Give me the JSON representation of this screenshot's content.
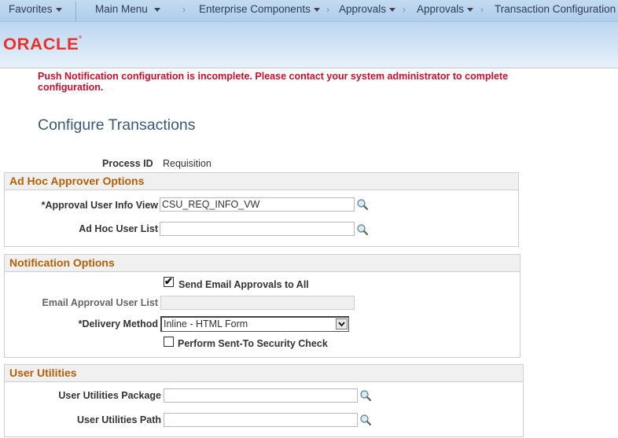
{
  "nav": {
    "favorites": "Favorites",
    "main_menu": "Main Menu",
    "breadcrumbs": [
      {
        "label": "Enterprise Components",
        "has_menu": true
      },
      {
        "label": "Approvals",
        "has_menu": true
      },
      {
        "label": "Approvals",
        "has_menu": true
      },
      {
        "label": "Transaction Configuration",
        "has_menu": false
      }
    ],
    "separator": "›"
  },
  "header": {
    "logo_text": "ORACLE",
    "logo_mark": "®"
  },
  "alert": {
    "message": "Push Notification configuration is incomplete. Please contact your system administrator to complete configuration.",
    "color": "#c8102e"
  },
  "page_title": "Configure Transactions",
  "process": {
    "label": "Process ID",
    "value": "Requisition"
  },
  "sections": {
    "ad_hoc": {
      "title": "Ad Hoc Approver Options",
      "approval_user_info_view": {
        "label": "*Approval User Info View",
        "value": "CSU_REQ_INFO_VW"
      },
      "ad_hoc_user_list": {
        "label": "Ad Hoc User List",
        "value": ""
      }
    },
    "notification": {
      "title": "Notification Options",
      "send_email_all": {
        "label": "Send Email Approvals to All",
        "checked": true
      },
      "email_approval_user_list": {
        "label": "Email Approval User List",
        "value": "",
        "disabled": true
      },
      "delivery_method": {
        "label": "*Delivery Method",
        "selected": "Inline - HTML Form"
      },
      "security_check": {
        "label": "Perform Sent-To Security Check",
        "checked": false
      }
    },
    "user_utilities": {
      "title": "User Utilities",
      "package": {
        "label": "User Utilities Package",
        "value": ""
      },
      "path": {
        "label": "User Utilities Path",
        "value": ""
      }
    }
  },
  "colors": {
    "section_title": "#b45f06",
    "page_title": "#3c5a78",
    "logo": "#e8322b"
  },
  "icons": {
    "lookup": "magnifier-icon",
    "checkmark": "✔"
  }
}
